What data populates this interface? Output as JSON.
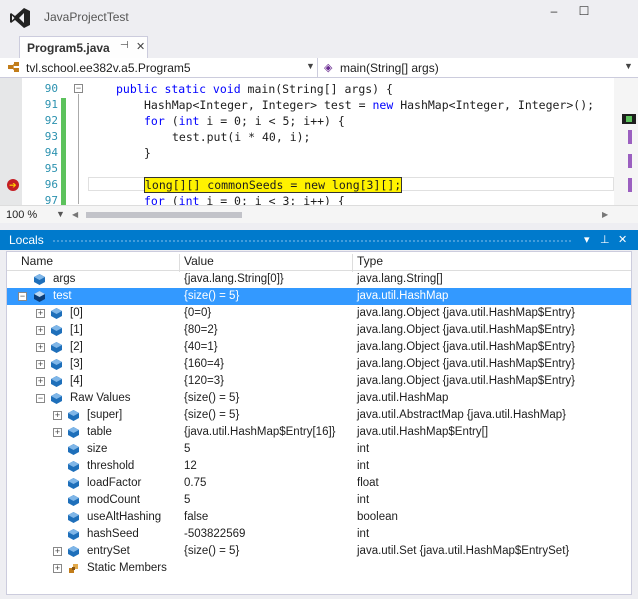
{
  "window": {
    "title": "JavaProjectTest",
    "minimize": "–",
    "maximize": "☐"
  },
  "tab": {
    "label": "Program5.java",
    "pin": "⊣",
    "close": "✕"
  },
  "navbar": {
    "left": "tvl.school.ee382v.a5.Program5",
    "right": "main(String[] args)"
  },
  "editor": {
    "lines": [
      {
        "num": "90",
        "code": "public static void main(String[] args) {"
      },
      {
        "num": "91",
        "code": "HashMap<Integer, Integer> test = new HashMap<Integer, Integer>();"
      },
      {
        "num": "92",
        "code": "for (int i = 0; i < 5; i++) {"
      },
      {
        "num": "93",
        "code": "test.put(i * 40, i);"
      },
      {
        "num": "94",
        "code": "}"
      },
      {
        "num": "95",
        "code": ""
      },
      {
        "num": "96",
        "code": "long[][] commonSeeds = new long[3][];"
      },
      {
        "num": "97",
        "code": "for (int i = 0; i < 3; i++) {"
      }
    ],
    "zoom": "100 %"
  },
  "locals": {
    "title": "Locals",
    "columns": [
      "Name",
      "Value",
      "Type"
    ],
    "rows": [
      {
        "name": "args",
        "value": "{java.lang.String[0]}",
        "type": "java.lang.String[]"
      },
      {
        "name": "test",
        "value": "{size() = 5}",
        "type": "java.util.HashMap"
      },
      {
        "name": "[0]",
        "value": "{0=0}",
        "type": "java.lang.Object {java.util.HashMap$Entry}"
      },
      {
        "name": "[1]",
        "value": "{80=2}",
        "type": "java.lang.Object {java.util.HashMap$Entry}"
      },
      {
        "name": "[2]",
        "value": "{40=1}",
        "type": "java.lang.Object {java.util.HashMap$Entry}"
      },
      {
        "name": "[3]",
        "value": "{160=4}",
        "type": "java.lang.Object {java.util.HashMap$Entry}"
      },
      {
        "name": "[4]",
        "value": "{120=3}",
        "type": "java.lang.Object {java.util.HashMap$Entry}"
      },
      {
        "name": "Raw Values",
        "value": "{size() = 5}",
        "type": "java.util.HashMap"
      },
      {
        "name": "[super]",
        "value": "{size() = 5}",
        "type": "java.util.AbstractMap {java.util.HashMap}"
      },
      {
        "name": "table",
        "value": "{java.util.HashMap$Entry[16]}",
        "type": "java.util.HashMap$Entry[]"
      },
      {
        "name": "size",
        "value": "5",
        "type": "int"
      },
      {
        "name": "threshold",
        "value": "12",
        "type": "int"
      },
      {
        "name": "loadFactor",
        "value": "0.75",
        "type": "float"
      },
      {
        "name": "modCount",
        "value": "5",
        "type": "int"
      },
      {
        "name": "useAltHashing",
        "value": "false",
        "type": "boolean"
      },
      {
        "name": "hashSeed",
        "value": "-503822569",
        "type": "int"
      },
      {
        "name": "entrySet",
        "value": "{size() = 5}",
        "type": "java.util.Set {java.util.HashMap$EntrySet}"
      },
      {
        "name": "Static Members",
        "value": "",
        "type": ""
      }
    ]
  }
}
